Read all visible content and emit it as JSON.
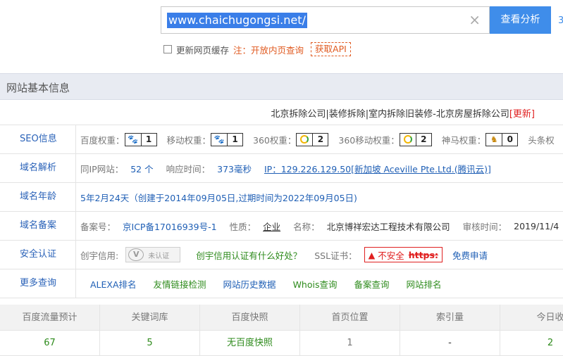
{
  "search": {
    "value": "www.chaichugongsi.net/",
    "clear_icon": "close-icon",
    "button_label": "查看分析",
    "more_label": "3"
  },
  "options": {
    "refresh_cache_label": "更新网页缓存",
    "note": "注：开放内页查询",
    "api_label": "获取API"
  },
  "section": {
    "title": "网站基本信息"
  },
  "site": {
    "title": "北京拆除公司|装修拆除|室内拆除旧装修-北京房屋拆除公司",
    "update_label": "[更新]"
  },
  "seo": {
    "label": "SEO信息",
    "baidu_label": "百度权重：",
    "baidu_value": "1",
    "mobile_label": "移动权重：",
    "mobile_value": "1",
    "s360_label": "360权重：",
    "s360_value": "2",
    "s360m_label": "360移动权重：",
    "s360m_value": "2",
    "shenma_label": "神马权重：",
    "shenma_value": "0",
    "toutiao_label": "头条权"
  },
  "dns": {
    "label": "域名解析",
    "same_ip_label": "同IP网站：",
    "same_ip_value": "52 个",
    "resp_label": "响应时间：",
    "resp_value": "373毫秒",
    "ip_value": "IP：129.226.129.50[新加坡 Aceville Pte.Ltd.(腾讯云)]"
  },
  "age": {
    "label": "域名年龄",
    "value": "5年2月24天（创建于2014年09月05日,过期时间为2022年09月05日)"
  },
  "icp": {
    "label": "域名备案",
    "num_label": "备案号：",
    "num_value": "京ICP备17016939号-1",
    "nature_label": "性质：",
    "nature_value": "企业",
    "name_label": "名称：",
    "name_value": "北京博祥宏达工程技术有限公司",
    "review_label": "审核时间：",
    "review_value": "2019/11/4"
  },
  "security": {
    "label": "安全认证",
    "credit_label": "创宇信用:",
    "cert_text": "未认证",
    "credit_link": "创宇信用认证有什么好处？",
    "ssl_label": "SSL证书：",
    "unsafe_label": "不安全",
    "https_label": "https:",
    "free_apply": "免费申请"
  },
  "more": {
    "label": "更多查询",
    "links": [
      "ALEXA排名",
      "友情链接检测",
      "网站历史数据",
      "Whois查询",
      "备案查询",
      "网站排名"
    ]
  },
  "stats": {
    "headers": [
      "百度流量预计",
      "关键词库",
      "百度快照",
      "首页位置",
      "索引量",
      "今日收"
    ],
    "values": [
      "67",
      "5",
      "无百度快照",
      "1",
      "-",
      "2"
    ]
  },
  "colors": {
    "accent": "#3f8dea",
    "link": "#1f5fb5",
    "green": "#2e8b1c",
    "warning": "#e05a20",
    "danger": "#e02020"
  }
}
